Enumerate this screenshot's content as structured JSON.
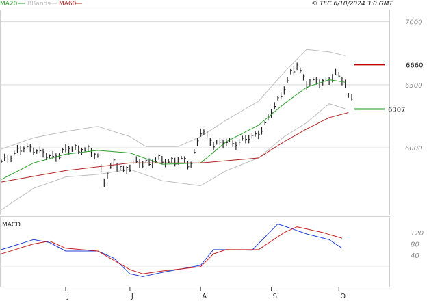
{
  "legend": {
    "ma20_label": "MA20",
    "bbands_label": "BBands",
    "ma60_label": "MA60",
    "ma20_color": "#2ca02c",
    "bbands_color": "#bdbdbd",
    "ma60_color": "#b22222"
  },
  "copyright": "© TEC 6/10/2024 3:0 GMT",
  "macd_title": "MACD",
  "levels": {
    "resistance_label": "6660",
    "resistance_color": "#c00000",
    "support_label": "6307",
    "support_color": "#1a9a1a"
  },
  "chart_data": [
    {
      "type": "line",
      "panel": "price",
      "y_ticks": [
        "7000",
        "6500",
        "6000"
      ],
      "y_tick_values": [
        7000,
        6500,
        6000
      ],
      "ylim": [
        5470,
        7090
      ],
      "x_ticks": [
        "J",
        "J",
        "A",
        "S",
        "O"
      ],
      "x_tick_index": [
        20,
        40,
        62,
        84,
        105
      ],
      "n_bars": 110,
      "levels": [
        6660,
        6307
      ],
      "series": [
        {
          "name": "MA20",
          "anchors": [
            [
              0,
              5750
            ],
            [
              10,
              5880
            ],
            [
              20,
              5950
            ],
            [
              30,
              5980
            ],
            [
              40,
              5960
            ],
            [
              50,
              5870
            ],
            [
              62,
              5880
            ],
            [
              70,
              6050
            ],
            [
              80,
              6180
            ],
            [
              88,
              6350
            ],
            [
              95,
              6480
            ],
            [
              102,
              6540
            ],
            [
              107,
              6520
            ]
          ]
        },
        {
          "name": "MA60",
          "anchors": [
            [
              0,
              5730
            ],
            [
              20,
              5820
            ],
            [
              40,
              5880
            ],
            [
              62,
              5880
            ],
            [
              80,
              5920
            ],
            [
              88,
              6050
            ],
            [
              95,
              6150
            ],
            [
              102,
              6240
            ],
            [
              108,
              6280
            ]
          ]
        },
        {
          "name": "BBands upper",
          "anchors": [
            [
              0,
              5990
            ],
            [
              10,
              6080
            ],
            [
              20,
              6130
            ],
            [
              30,
              6170
            ],
            [
              40,
              6090
            ],
            [
              45,
              6010
            ],
            [
              55,
              6010
            ],
            [
              62,
              6090
            ],
            [
              70,
              6220
            ],
            [
              80,
              6370
            ],
            [
              88,
              6600
            ],
            [
              95,
              6780
            ],
            [
              102,
              6760
            ],
            [
              107,
              6730
            ]
          ]
        },
        {
          "name": "BBands lower",
          "anchors": [
            [
              0,
              5510
            ],
            [
              10,
              5680
            ],
            [
              20,
              5770
            ],
            [
              30,
              5790
            ],
            [
              40,
              5830
            ],
            [
              50,
              5740
            ],
            [
              62,
              5700
            ],
            [
              70,
              5820
            ],
            [
              80,
              5920
            ],
            [
              88,
              6090
            ],
            [
              95,
              6200
            ],
            [
              102,
              6350
            ],
            [
              107,
              6310
            ]
          ]
        },
        {
          "name": "Price",
          "anchors": [
            [
              0,
              5880
            ],
            [
              5,
              5980
            ],
            [
              10,
              6000
            ],
            [
              15,
              5920
            ],
            [
              20,
              5980
            ],
            [
              25,
              6000
            ],
            [
              30,
              5930
            ],
            [
              32,
              5750
            ],
            [
              35,
              5870
            ],
            [
              38,
              5830
            ],
            [
              42,
              5880
            ],
            [
              50,
              5900
            ],
            [
              55,
              5900
            ],
            [
              59,
              5880
            ],
            [
              62,
              6130
            ],
            [
              66,
              6040
            ],
            [
              72,
              6040
            ],
            [
              78,
              6080
            ],
            [
              82,
              6180
            ],
            [
              86,
              6380
            ],
            [
              90,
              6580
            ],
            [
              92,
              6650
            ],
            [
              95,
              6520
            ],
            [
              100,
              6520
            ],
            [
              104,
              6580
            ],
            [
              107,
              6520
            ],
            [
              108,
              6410
            ]
          ]
        }
      ]
    },
    {
      "type": "line",
      "panel": "macd",
      "y_ticks": [
        "120",
        "80",
        "40"
      ],
      "y_tick_values": [
        120,
        80,
        40
      ],
      "ylim": [
        -70,
        175
      ],
      "series": [
        {
          "name": "MACD",
          "anchors": [
            [
              0,
              60
            ],
            [
              10,
              95
            ],
            [
              15,
              85
            ],
            [
              20,
              55
            ],
            [
              30,
              55
            ],
            [
              35,
              30
            ],
            [
              40,
              -25
            ],
            [
              44,
              -35
            ],
            [
              50,
              -20
            ],
            [
              62,
              5
            ],
            [
              66,
              60
            ],
            [
              70,
              60
            ],
            [
              78,
              58
            ],
            [
              86,
              150
            ],
            [
              90,
              135
            ],
            [
              95,
              115
            ],
            [
              102,
              95
            ],
            [
              106,
              65
            ]
          ]
        },
        {
          "name": "Signal",
          "anchors": [
            [
              0,
              45
            ],
            [
              10,
              80
            ],
            [
              15,
              90
            ],
            [
              20,
              65
            ],
            [
              30,
              55
            ],
            [
              40,
              -10
            ],
            [
              44,
              -25
            ],
            [
              50,
              -15
            ],
            [
              62,
              0
            ],
            [
              66,
              45
            ],
            [
              70,
              60
            ],
            [
              80,
              60
            ],
            [
              88,
              120
            ],
            [
              92,
              140
            ],
            [
              100,
              120
            ],
            [
              106,
              100
            ]
          ]
        }
      ]
    }
  ]
}
